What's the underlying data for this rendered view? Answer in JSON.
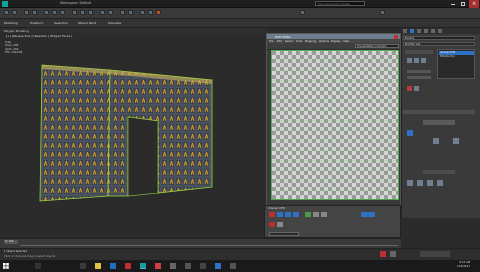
{
  "titlebar": {
    "title": "Workspace: Default",
    "search_placeholder": "Type a keyword or phrase"
  },
  "ribbon": {
    "items": [
      "Modeling",
      "Freeform",
      "Selection",
      "Object Paint",
      "Populate"
    ],
    "sub_label": "Polygon Modeling"
  },
  "viewport": {
    "label": "[+] [Perspective ] [Realistic ] [Edged Faces ]",
    "stats": [
      "Total",
      "Polys: 208",
      "Verts: 269",
      "FPS: 180.009"
    ]
  },
  "uv_editor": {
    "title": "Edit UVWs",
    "menus": [
      "File",
      "Edit",
      "Select",
      "Tools",
      "Mapping",
      "Options",
      "Display",
      "View"
    ],
    "checker_dropdown": "CheckerPattern (Checker)"
  },
  "command_panel": {
    "tabs": [
      "Create",
      "Modify",
      "Hierarchy",
      "Motion",
      "Display",
      "Utilities"
    ],
    "object_name": "Box001",
    "modifier_list": "Modifier List",
    "stack": [
      "Unwrap UVW",
      "Editable Poly"
    ]
  },
  "unwrap_panel": {
    "label": "Unwrap UVW"
  },
  "timeline": {
    "frame": "0 / 100"
  },
  "status": {
    "selection": "1 Object Selected",
    "prompt": "Click or click-and-drag to select objects"
  },
  "taskbar": {
    "time": "8:15 AM",
    "date": "12/5/2017"
  },
  "colors": {
    "accent": "#2d72c4",
    "uv_green": "#6bcf6b",
    "mesh_gold": "#d4a017"
  }
}
